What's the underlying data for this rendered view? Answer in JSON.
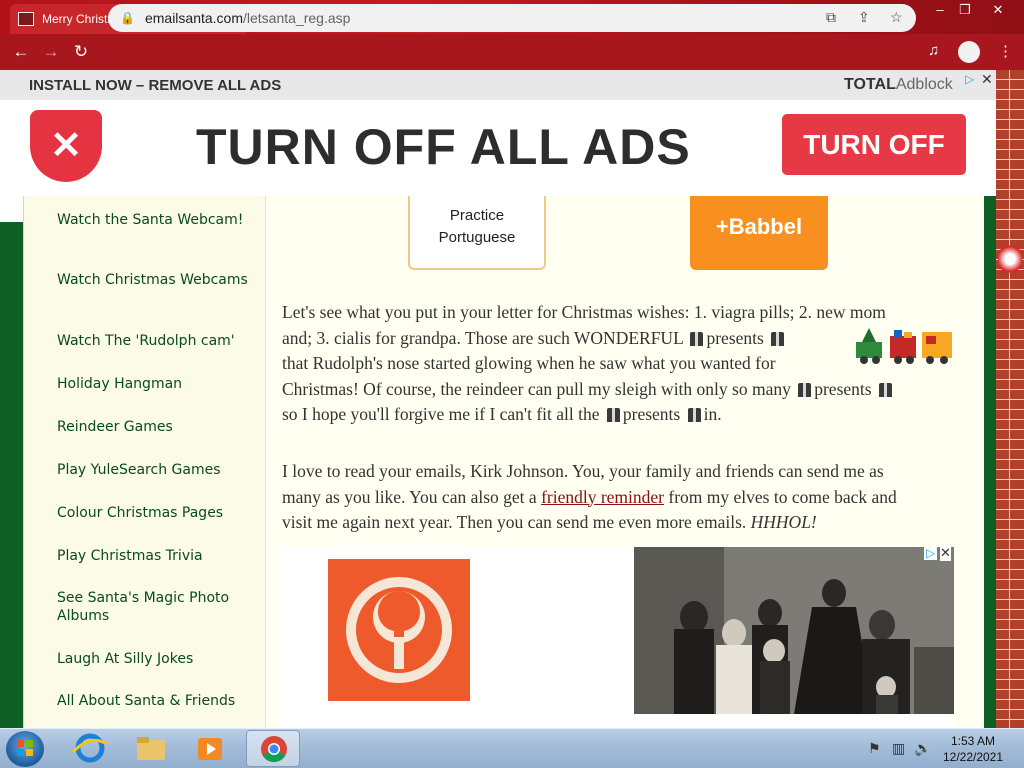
{
  "browser": {
    "tab_title": "Merry Christmas from emailSanta.com",
    "tab_close": "✕",
    "new_tab": "+",
    "url_domain": "emailsanta.com",
    "url_path": "/letsanta_reg.asp",
    "window_controls": [
      "–",
      "❐",
      "✕"
    ],
    "nav": {
      "back": "←",
      "forward": "→",
      "reload": "↻"
    }
  },
  "ad_banner": {
    "top_text": "INSTALL NOW – REMOVE ALL ADS",
    "brand_bold": "TOTAL",
    "brand_light": "Adblock",
    "headline": "TURN OFF ALL ADS",
    "button_label": "TURN OFF",
    "collapse_glyph": "⌃"
  },
  "sidebar": {
    "items": [
      {
        "label": "Watch the Santa Webcam!"
      },
      {
        "label": "Watch Christmas Webcams"
      },
      {
        "label": "Watch The 'Rudolph cam'"
      },
      {
        "label": "Holiday Hangman"
      },
      {
        "label": "Reindeer Games"
      },
      {
        "label": "Play YuleSearch Games"
      },
      {
        "label": "Colour Christmas Pages"
      },
      {
        "label": "Play Christmas Trivia"
      },
      {
        "label": "See Santa's Magic Photo Albums"
      },
      {
        "label": "Laugh At Silly Jokes"
      },
      {
        "label": "All About Santa & Friends"
      }
    ]
  },
  "top_ads": {
    "language_card": [
      "Practice",
      "Portuguese"
    ],
    "babbel_label": "+Babbel"
  },
  "letter": {
    "p1": {
      "l1": "Let's see what you put in your letter for Christmas wishes: 1. viagra pills; 2. new mom",
      "l2a": "and; 3. cialis for grandpa.  Those are such WONDERFUL",
      "l2b": "presents",
      "l3": "that Rudolph's nose started glowing when he saw what you wanted for",
      "l4a": "Christmas!  Of course, the reindeer can pull my sleigh with only so many",
      "l4b": "presents",
      "l5a": "so I hope you'll forgive me if I can't fit all the",
      "l5b": "presents",
      "l5c": "in."
    },
    "p2": {
      "l1": "I love to read your emails, Kirk Johnson.  You, your family and friends can send me as",
      "l2a": "many as you like.  You can also get a",
      "l2_link": "friendly reminder",
      "l2b": "from my elves to come back and",
      "l3a": "visit me again next year.  Then you can send me even more emails.",
      "l3_em": "HHHOL!"
    }
  },
  "taskbar": {
    "time": "1:53 AM",
    "date": "12/22/2021"
  },
  "colors": {
    "sidebar_link": "#0a4a20",
    "ad_red": "#e63945",
    "babbel_orange": "#f7901e",
    "page_green": "#0e5f23"
  }
}
